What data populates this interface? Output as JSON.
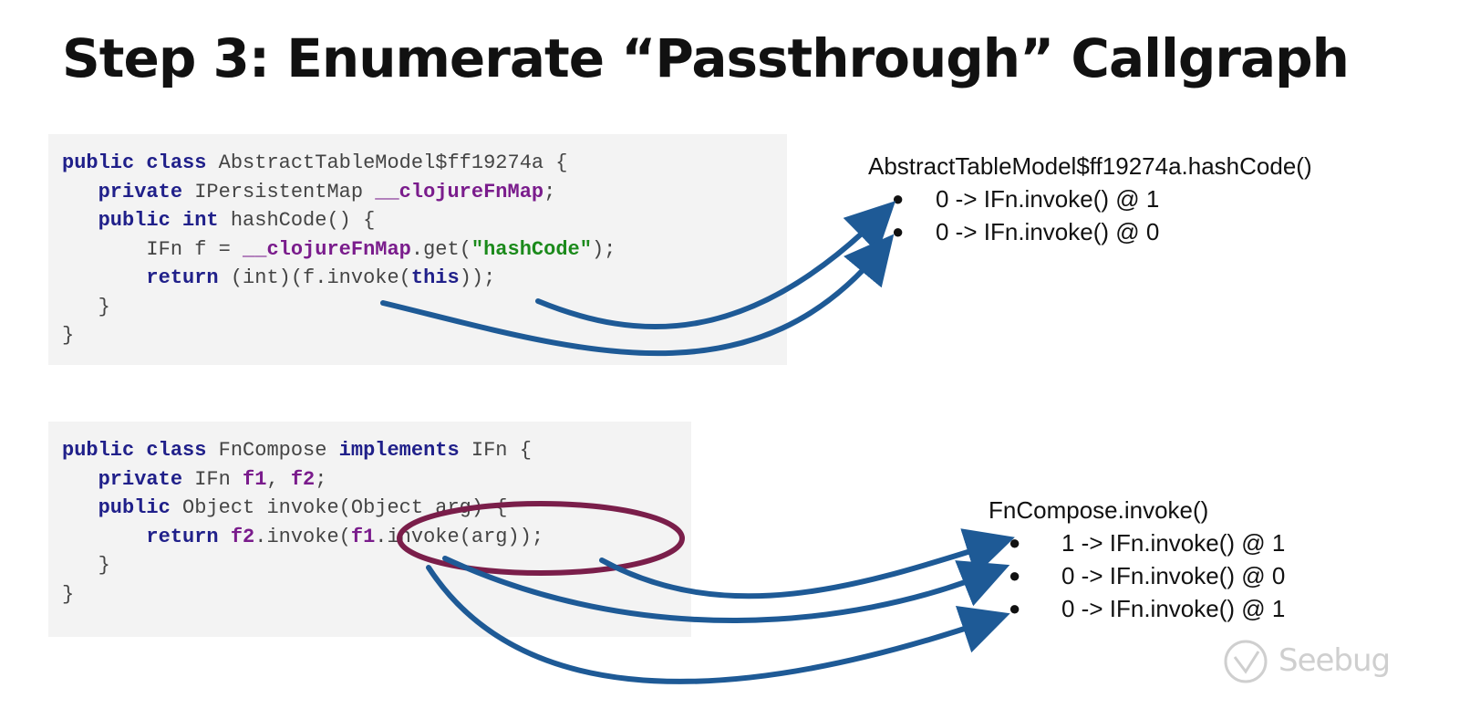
{
  "slide": {
    "title": "Step 3: Enumerate “Passthrough” Callgraph"
  },
  "code_block_1": [
    "public class AbstractTableModel$ff19274a {",
    "   private IPersistentMap __clojureFnMap;",
    "   public int hashCode() {",
    "       IFn f = __clojureFnMap.get(\"hashCode\");",
    "       return (int)(f.invoke(this));",
    "   }",
    "}"
  ],
  "code_block_2": [
    "public class FnCompose implements IFn {",
    "   private IFn f1, f2;",
    "   public Object invoke(Object arg) {",
    "       return f2.invoke(f1.invoke(arg));",
    "   }",
    "}"
  ],
  "callgraph_1": {
    "header": "AbstractTableModel$ff19274a.hashCode()",
    "bullet": "●",
    "items": [
      "0 -> IFn.invoke() @ 1",
      "0 -> IFn.invoke() @ 0"
    ]
  },
  "callgraph_2": {
    "header": "FnCompose.invoke()",
    "bullet": "●",
    "items": [
      "1 -> IFn.invoke() @ 1",
      "0 -> IFn.invoke() @ 0",
      "0 -> IFn.invoke() @ 1"
    ]
  },
  "watermark": {
    "text": "Seebug",
    "color": "#cfcfcf"
  },
  "colors": {
    "arrow": "#1e5a96",
    "highlight_ellipse": "#7a1e4a",
    "keyword": "#20208a",
    "field": "#7a1c8c",
    "string": "#1b8a1b",
    "code_bg": "#f3f3f3"
  }
}
